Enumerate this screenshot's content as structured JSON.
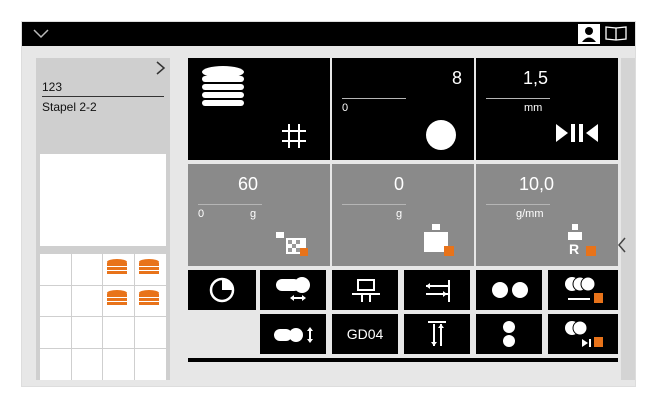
{
  "header": {
    "menu_icon": "chevron-down-icon",
    "user_icon": "user-icon",
    "book_icon": "book-icon"
  },
  "left_panel": {
    "id": "123",
    "name": "Stapel 2-2",
    "expand_icon": "chevron-right-icon"
  },
  "tiles": {
    "stack": {
      "icon": "stack-icon",
      "grid_icon": "grid-hash-icon"
    },
    "count": {
      "value": "8",
      "min": "0",
      "icon": "circle-icon"
    },
    "thickness": {
      "value": "1,5",
      "unit": "mm",
      "icon": "squeeze-icon"
    },
    "weight": {
      "value": "60",
      "min": "0",
      "unit": "g",
      "icon": "weight-lock-icon"
    },
    "tare": {
      "value": "0",
      "unit": "g",
      "icon": "tare-lock-icon"
    },
    "density": {
      "value": "10,0",
      "unit": "g/mm",
      "icon": "reset-lock-icon"
    }
  },
  "buttons_row1": [
    "pie-chart-icon",
    "roll-horizontal-icon",
    "press-icon",
    "width-adjust-icon",
    "two-dots-icon",
    "rollers-lock-icon"
  ],
  "buttons_row2": {
    "gd_label": "GD04",
    "icons": [
      "roll-vertical-icon",
      "height-adjust-icon",
      "vertical-dots-icon",
      "rollers-lock2-icon"
    ]
  },
  "side_arrow_icon": "chevron-left-icon",
  "colors": {
    "accent": "#e8731a",
    "tile_black": "#000000",
    "tile_grey": "#8a8a8a"
  }
}
